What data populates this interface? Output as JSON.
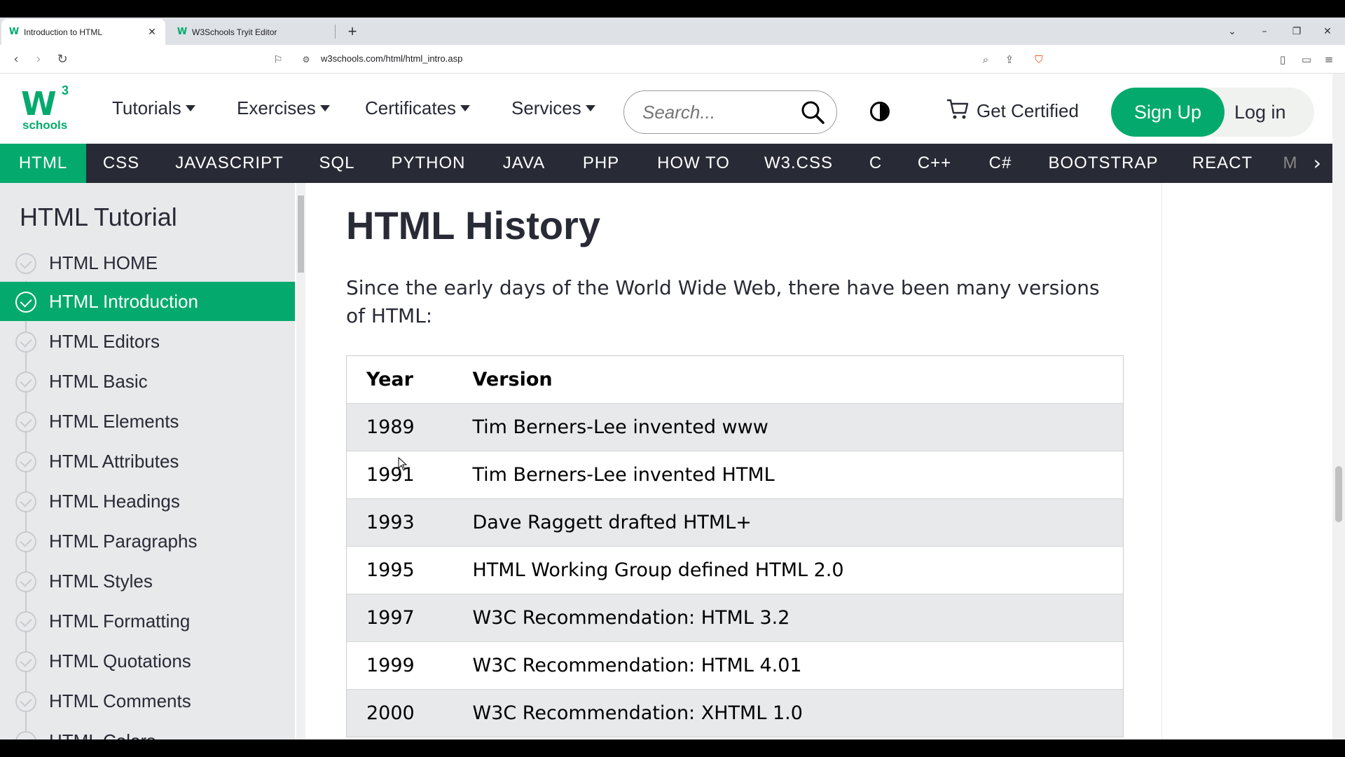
{
  "browser": {
    "tabs": [
      {
        "title": "Introduction to HTML",
        "active": true
      },
      {
        "title": "W3Schools Tryit Editor",
        "active": false
      }
    ],
    "url": "w3schools.com/html/html_intro.asp"
  },
  "header": {
    "logo_sup": "3",
    "logo_text": "schools",
    "nav": [
      "Tutorials",
      "Exercises",
      "Certificates",
      "Services"
    ],
    "search_placeholder": "Search...",
    "get_certified": "Get Certified",
    "sign_up": "Sign Up",
    "log_in": "Log in"
  },
  "topics": [
    "HTML",
    "CSS",
    "JAVASCRIPT",
    "SQL",
    "PYTHON",
    "JAVA",
    "PHP",
    "HOW TO",
    "W3.CSS",
    "C",
    "C++",
    "C#",
    "BOOTSTRAP",
    "REACT",
    "M"
  ],
  "sidebar": {
    "title": "HTML Tutorial",
    "items": [
      "HTML HOME",
      "HTML Introduction",
      "HTML Editors",
      "HTML Basic",
      "HTML Elements",
      "HTML Attributes",
      "HTML Headings",
      "HTML Paragraphs",
      "HTML Styles",
      "HTML Formatting",
      "HTML Quotations",
      "HTML Comments",
      "HTML Colors"
    ],
    "active_index": 1
  },
  "main": {
    "heading": "HTML History",
    "intro": "Since the early days of the World Wide Web, there have been many versions of HTML:",
    "table": {
      "headers": [
        "Year",
        "Version"
      ],
      "rows": [
        [
          "1989",
          "Tim Berners-Lee invented www"
        ],
        [
          "1991",
          "Tim Berners-Lee invented HTML"
        ],
        [
          "1993",
          "Dave Raggett drafted HTML+"
        ],
        [
          "1995",
          "HTML Working Group defined HTML 2.0"
        ],
        [
          "1997",
          "W3C Recommendation: HTML 3.2"
        ],
        [
          "1999",
          "W3C Recommendation: HTML 4.01"
        ],
        [
          "2000",
          "W3C Recommendation: XHTML 1.0"
        ]
      ]
    }
  },
  "colors": {
    "accent": "#04aa6d",
    "dark": "#282a35",
    "sidebar_bg": "#e7e9eb"
  }
}
